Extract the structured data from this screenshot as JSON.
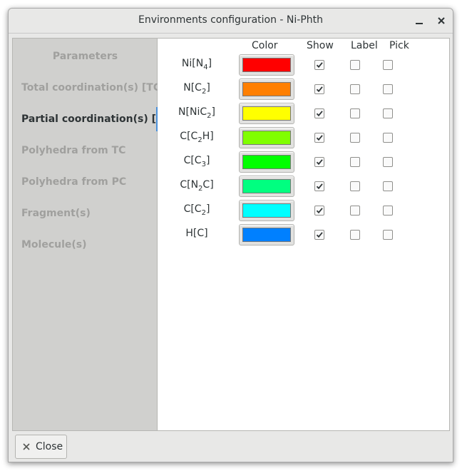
{
  "window": {
    "title": "Environments configuration - Ni-Phth"
  },
  "sidebar": {
    "items": [
      {
        "label": "Parameters",
        "active": false
      },
      {
        "label": "Total coordination(s) [TC]",
        "active": false
      },
      {
        "label": "Partial coordination(s) [PC]",
        "active": true
      },
      {
        "label": "Polyhedra from TC",
        "active": false
      },
      {
        "label": "Polyhedra from PC",
        "active": false
      },
      {
        "label": "Fragment(s)",
        "active": false
      },
      {
        "label": "Molecule(s)",
        "active": false
      }
    ]
  },
  "table": {
    "headers": {
      "color": "Color",
      "show": "Show",
      "label": "Label",
      "pick": "Pick"
    },
    "rows": [
      {
        "parts": [
          "Ni[N",
          "4",
          "]"
        ],
        "color": "#ff0000",
        "show": true,
        "label": false,
        "pick": false
      },
      {
        "parts": [
          "N[C",
          "2",
          "]"
        ],
        "color": "#ff7f00",
        "show": true,
        "label": false,
        "pick": false
      },
      {
        "parts": [
          "N[NiC",
          "2",
          "]"
        ],
        "color": "#ffff00",
        "show": true,
        "label": false,
        "pick": false
      },
      {
        "parts": [
          "C[C",
          "2",
          "H]"
        ],
        "color": "#80ff00",
        "show": true,
        "label": false,
        "pick": false
      },
      {
        "parts": [
          "C[C",
          "3",
          "]"
        ],
        "color": "#00ff00",
        "show": true,
        "label": false,
        "pick": false
      },
      {
        "parts": [
          "C[N",
          "2",
          "C]"
        ],
        "color": "#00ff80",
        "show": true,
        "label": false,
        "pick": false
      },
      {
        "parts": [
          "C[C",
          "2",
          "]"
        ],
        "color": "#00ffff",
        "show": true,
        "label": false,
        "pick": false
      },
      {
        "parts": [
          "H[C]",
          "",
          ""
        ],
        "color": "#0080ff",
        "show": true,
        "label": false,
        "pick": false
      }
    ]
  },
  "footer": {
    "close_label": "Close"
  },
  "icons": {
    "window_close": "close-icon",
    "window_minimize": "minimize-icon",
    "checkmark": "checkmark-icon",
    "close_button": "close-icon"
  }
}
